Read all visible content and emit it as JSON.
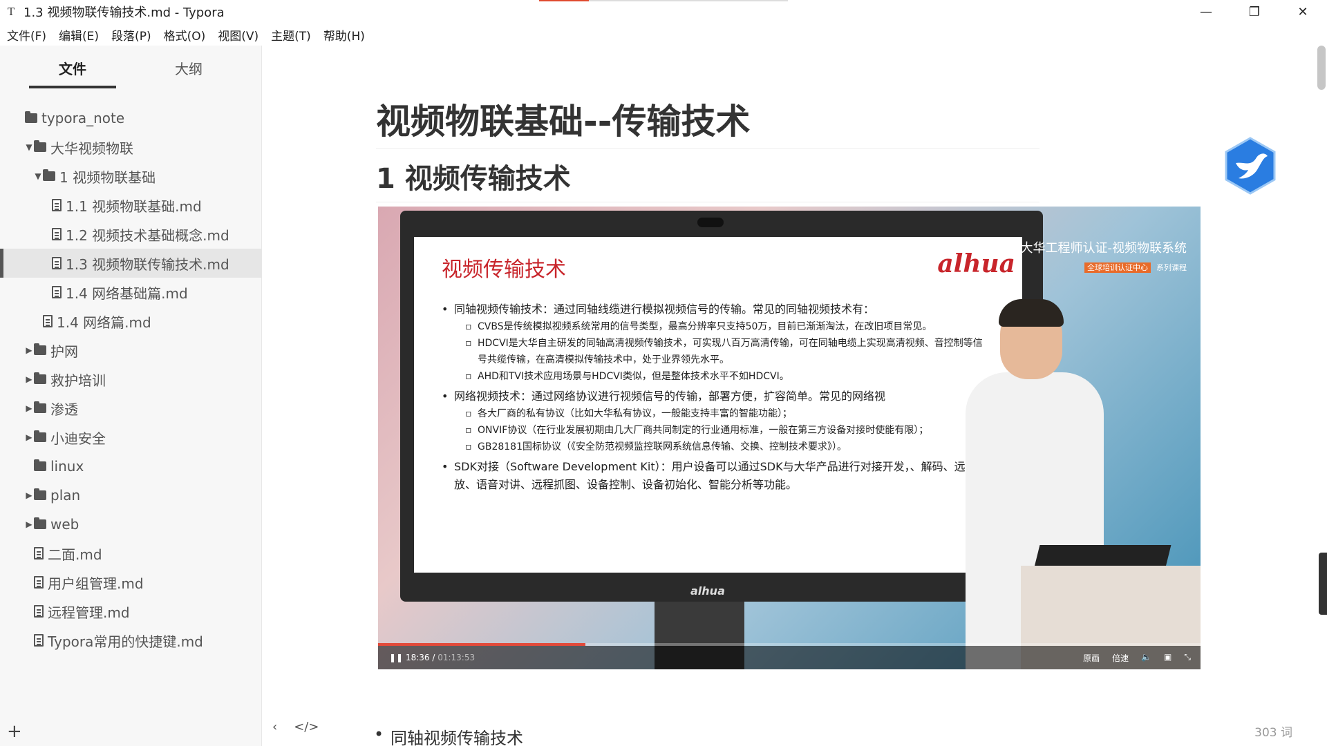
{
  "window": {
    "app_icon": "T",
    "title": "1.3 视频物联传输技术.md - Typora",
    "controls": {
      "minimize": "—",
      "restore": "❐",
      "close": "✕"
    }
  },
  "menu": [
    "文件(F)",
    "编辑(E)",
    "段落(P)",
    "格式(O)",
    "视图(V)",
    "主题(T)",
    "帮助(H)"
  ],
  "sidebar": {
    "tabs": {
      "files": "文件",
      "outline": "大纲"
    },
    "tree": [
      {
        "label": "typora_note",
        "type": "folder",
        "indent": 0,
        "arrow": ""
      },
      {
        "label": "大华视频物联",
        "type": "folder",
        "indent": 1,
        "arrow": "expanded"
      },
      {
        "label": "1 视频物联基础",
        "type": "folder",
        "indent": 2,
        "arrow": "expanded"
      },
      {
        "label": "1.1 视频物联基础.md",
        "type": "file",
        "indent": 3
      },
      {
        "label": "1.2 视频技术基础概念.md",
        "type": "file",
        "indent": 3
      },
      {
        "label": "1.3 视频物联传输技术.md",
        "type": "file",
        "indent": 3,
        "selected": true
      },
      {
        "label": "1.4 网络基础篇.md",
        "type": "file",
        "indent": 3
      },
      {
        "label": "1.4 网络篇.md",
        "type": "file",
        "indent": 2
      },
      {
        "label": "护网",
        "type": "folder",
        "indent": 1,
        "arrow": "collapsed"
      },
      {
        "label": "救护培训",
        "type": "folder",
        "indent": 1,
        "arrow": "collapsed"
      },
      {
        "label": "渗透",
        "type": "folder",
        "indent": 1,
        "arrow": "collapsed"
      },
      {
        "label": "小迪安全",
        "type": "folder",
        "indent": 1,
        "arrow": "collapsed"
      },
      {
        "label": "linux",
        "type": "folder",
        "indent": 1,
        "arrow": ""
      },
      {
        "label": "plan",
        "type": "folder",
        "indent": 1,
        "arrow": "collapsed"
      },
      {
        "label": "web",
        "type": "folder",
        "indent": 1,
        "arrow": "collapsed"
      },
      {
        "label": "二面.md",
        "type": "file",
        "indent": 1
      },
      {
        "label": "用户组管理.md",
        "type": "file",
        "indent": 1
      },
      {
        "label": "远程管理.md",
        "type": "file",
        "indent": 1
      },
      {
        "label": "Typora常用的快捷键.md",
        "type": "file",
        "indent": 1
      }
    ],
    "add_button": "+"
  },
  "document": {
    "h1": "视频物联基础--传输技术",
    "h2": "1 视频传输技术",
    "bottom_bullet": "同轴视频传输技术"
  },
  "video": {
    "slide_title": "视频传输技术",
    "logo": "alhua",
    "course_title": "大华工程师认证-视频物联系统",
    "course_tag": "全球培训认证中心",
    "course_series": "系列课程",
    "monitor_brand": "alhua",
    "slide_lines": [
      {
        "level": 1,
        "text": "同轴视频传输技术：通过同轴线缆进行模拟视频信号的传输。常见的同轴视频技术有："
      },
      {
        "level": 2,
        "text": "CVBS是传统模拟视频系统常用的信号类型，最高分辨率只支持50万，目前已渐渐淘汰，在改旧项目常见。"
      },
      {
        "level": 2,
        "text": "HDCVI是大华自主研发的同轴高清视频传输技术，可实现八百万高清传输，可在同轴电缆上实现高清视频、音控制等信号共缆传输，在高清模拟传输技术中，处于业界领先水平。"
      },
      {
        "level": 2,
        "text": "AHD和TVI技术应用场景与HDCVI类似，但是整体技术水平不如HDCVI。"
      },
      {
        "level": 1,
        "text": "网络视频技术：通过网络协议进行视频信号的传输，部署方便，扩容简单。常见的网络视"
      },
      {
        "level": 2,
        "text": "各大厂商的私有协议（比如大华私有协议，一般能支持丰富的智能功能）；"
      },
      {
        "level": 2,
        "text": "ONVIF协议（在行业发展初期由几大厂商共同制定的行业通用标准，一般在第三方设备对接时使能有限）；"
      },
      {
        "level": 2,
        "text": "GB28181国标协议（《安全防范视频监控联网系统信息传输、交换、控制技术要求》）。"
      },
      {
        "level": 1,
        "text": "SDK对接（Software Development Kit）：用户设备可以通过SDK与大华产品进行对接开发，、解码、远程回放、语音对讲、远程抓图、设备控制、设备初始化、智能分析等功能。"
      }
    ],
    "player": {
      "play_icon": "❚❚",
      "current_time": "18:36",
      "total_time": "01:13:53",
      "progress": 0.252,
      "controls": [
        "原画",
        "倍速",
        "🔈",
        "▣",
        "⤡"
      ]
    }
  },
  "footer": {
    "back": "‹",
    "source": "</>",
    "word_count": "303 词"
  }
}
